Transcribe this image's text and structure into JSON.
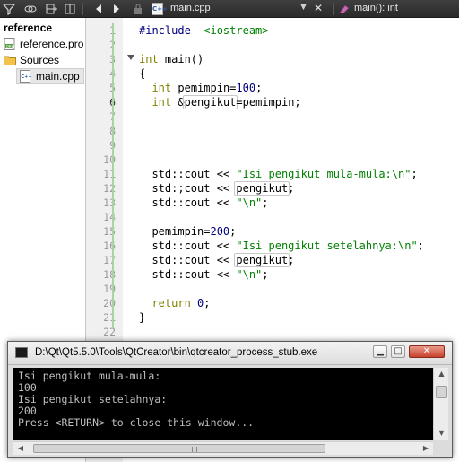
{
  "toolbar": {
    "file_tab": {
      "name": "main.cpp",
      "icon_text": "C++"
    },
    "symbol_tab": {
      "name": "main(): int"
    }
  },
  "sidebar": {
    "project": "reference",
    "items": [
      {
        "label": "reference.pro",
        "icon": "project-file-icon"
      },
      {
        "label": "Sources",
        "icon": "folder-icon"
      },
      {
        "label": "main.cpp",
        "icon": "cpp-file-icon"
      }
    ]
  },
  "editor": {
    "current_line": 6,
    "line_numbers": [
      "1",
      "2",
      "3",
      "4",
      "5",
      "6",
      "7",
      "8",
      "9",
      "10",
      "11",
      "12",
      "13",
      "14",
      "15",
      "16",
      "17",
      "18",
      "19",
      "20",
      "21",
      "22"
    ],
    "lines": [
      {
        "n": 1,
        "segments": [
          {
            "t": "#include  ",
            "c": "pp"
          },
          {
            "t": "<iostream>",
            "c": "str"
          }
        ]
      },
      {
        "n": 2,
        "segments": []
      },
      {
        "n": 3,
        "segments": [
          {
            "t": "int",
            "c": "kw"
          },
          {
            "t": " main()",
            "c": ""
          }
        ]
      },
      {
        "n": 4,
        "segments": [
          {
            "t": "{",
            "c": ""
          }
        ]
      },
      {
        "n": 5,
        "segments": [
          {
            "t": "  ",
            "c": ""
          },
          {
            "t": "int",
            "c": "kw"
          },
          {
            "t": " pemimpin=",
            "c": ""
          },
          {
            "t": "100",
            "c": "num"
          },
          {
            "t": ";",
            "c": ""
          }
        ]
      },
      {
        "n": 6,
        "segments": [
          {
            "t": "  ",
            "c": ""
          },
          {
            "t": "int",
            "c": "kw"
          },
          {
            "t": " &",
            "c": ""
          },
          {
            "t": "pengikut",
            "c": "ref"
          },
          {
            "t": "=pemimpin;",
            "c": ""
          }
        ]
      },
      {
        "n": 7,
        "segments": []
      },
      {
        "n": 8,
        "segments": []
      },
      {
        "n": 9,
        "segments": []
      },
      {
        "n": 10,
        "segments": []
      },
      {
        "n": 11,
        "segments": [
          {
            "t": "  std::cout << ",
            "c": ""
          },
          {
            "t": "\"Isi pengikut mula-mula:\\n\"",
            "c": "str"
          },
          {
            "t": ";",
            "c": ""
          }
        ]
      },
      {
        "n": 12,
        "segments": [
          {
            "t": "  std:;cout << ",
            "c": ""
          },
          {
            "t": "pengikut",
            "c": "ref"
          },
          {
            "t": ";",
            "c": ""
          }
        ]
      },
      {
        "n": 13,
        "segments": [
          {
            "t": "  std::cout << ",
            "c": ""
          },
          {
            "t": "\"\\n\"",
            "c": "str"
          },
          {
            "t": ";",
            "c": ""
          }
        ]
      },
      {
        "n": 14,
        "segments": []
      },
      {
        "n": 15,
        "segments": [
          {
            "t": "  pemimpin=",
            "c": ""
          },
          {
            "t": "200",
            "c": "num"
          },
          {
            "t": ";",
            "c": ""
          }
        ]
      },
      {
        "n": 16,
        "segments": [
          {
            "t": "  std::cout << ",
            "c": ""
          },
          {
            "t": "\"Isi pengikut setelahnya:\\n\"",
            "c": "str"
          },
          {
            "t": ";",
            "c": ""
          }
        ]
      },
      {
        "n": 17,
        "segments": [
          {
            "t": "  std::cout << ",
            "c": ""
          },
          {
            "t": "pengikut",
            "c": "ref"
          },
          {
            "t": ";",
            "c": ""
          }
        ]
      },
      {
        "n": 18,
        "segments": [
          {
            "t": "  std::cout << ",
            "c": ""
          },
          {
            "t": "\"\\n\"",
            "c": "str"
          },
          {
            "t": ";",
            "c": ""
          }
        ]
      },
      {
        "n": 19,
        "segments": []
      },
      {
        "n": 20,
        "segments": [
          {
            "t": "  ",
            "c": ""
          },
          {
            "t": "return",
            "c": "kw"
          },
          {
            "t": " ",
            "c": ""
          },
          {
            "t": "0",
            "c": "num"
          },
          {
            "t": ";",
            "c": ""
          }
        ]
      },
      {
        "n": 21,
        "segments": [
          {
            "t": "}",
            "c": ""
          }
        ]
      },
      {
        "n": 22,
        "segments": []
      }
    ]
  },
  "console": {
    "title": "D:\\Qt\\Qt5.5.0\\Tools\\QtCreator\\bin\\qtcreator_process_stub.exe",
    "output": [
      "Isi pengikut mula-mula:",
      "100",
      "Isi pengikut setelahnya:",
      "200",
      "Press <RETURN> to close this window..."
    ]
  },
  "colors": {
    "keyword": "#808000",
    "string": "#008000",
    "number": "#000080",
    "preprocessor": "#000080",
    "change_bar": "#a8d59a",
    "console_bg": "#000000",
    "console_text": "#c0c0c0"
  }
}
